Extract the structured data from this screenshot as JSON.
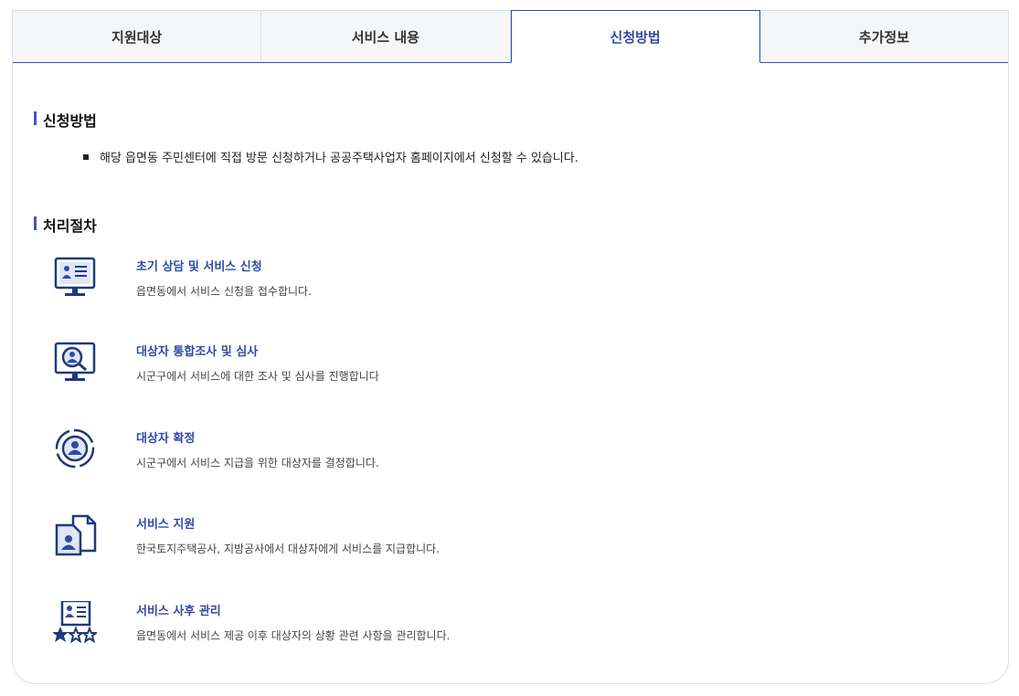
{
  "tabs": [
    {
      "label": "지원대상"
    },
    {
      "label": "서비스 내용"
    },
    {
      "label": "신청방법"
    },
    {
      "label": "추가정보"
    }
  ],
  "sections": {
    "apply": {
      "title": "신청방법",
      "bullet": "해당 읍면동 주민센터에 직접 방문 신청하거나 공공주택사업자 홈페이지에서 신청할 수 있습니다."
    },
    "process": {
      "title": "처리절차",
      "steps": [
        {
          "title": "초기 상담 및 서비스 신청",
          "desc": "읍면동에서 서비스 신청을 접수합니다.",
          "icon": "monitor-profile-icon"
        },
        {
          "title": "대상자 통합조사 및 심사",
          "desc": "시군구에서 서비스에 대한 조사 및 심사를 진행합니다",
          "icon": "search-person-icon"
        },
        {
          "title": "대상자 확정",
          "desc": "시군구에서 서비스 지급을 위한 대상자를 결정합니다.",
          "icon": "target-person-icon"
        },
        {
          "title": "서비스 지원",
          "desc": "한국토지주택공사, 지방공사에서 대상자에게 서비스를 지급합니다.",
          "icon": "document-person-icon"
        },
        {
          "title": "서비스 사후 관리",
          "desc": "읍면동에서 서비스 제공 이후 대상자의 상황 관련 사항을 관리합니다.",
          "icon": "rating-profile-icon"
        }
      ]
    }
  },
  "colors": {
    "accent": "#2f4aa5",
    "icon": "#1f3a7a",
    "marker": "#3c55c8"
  }
}
